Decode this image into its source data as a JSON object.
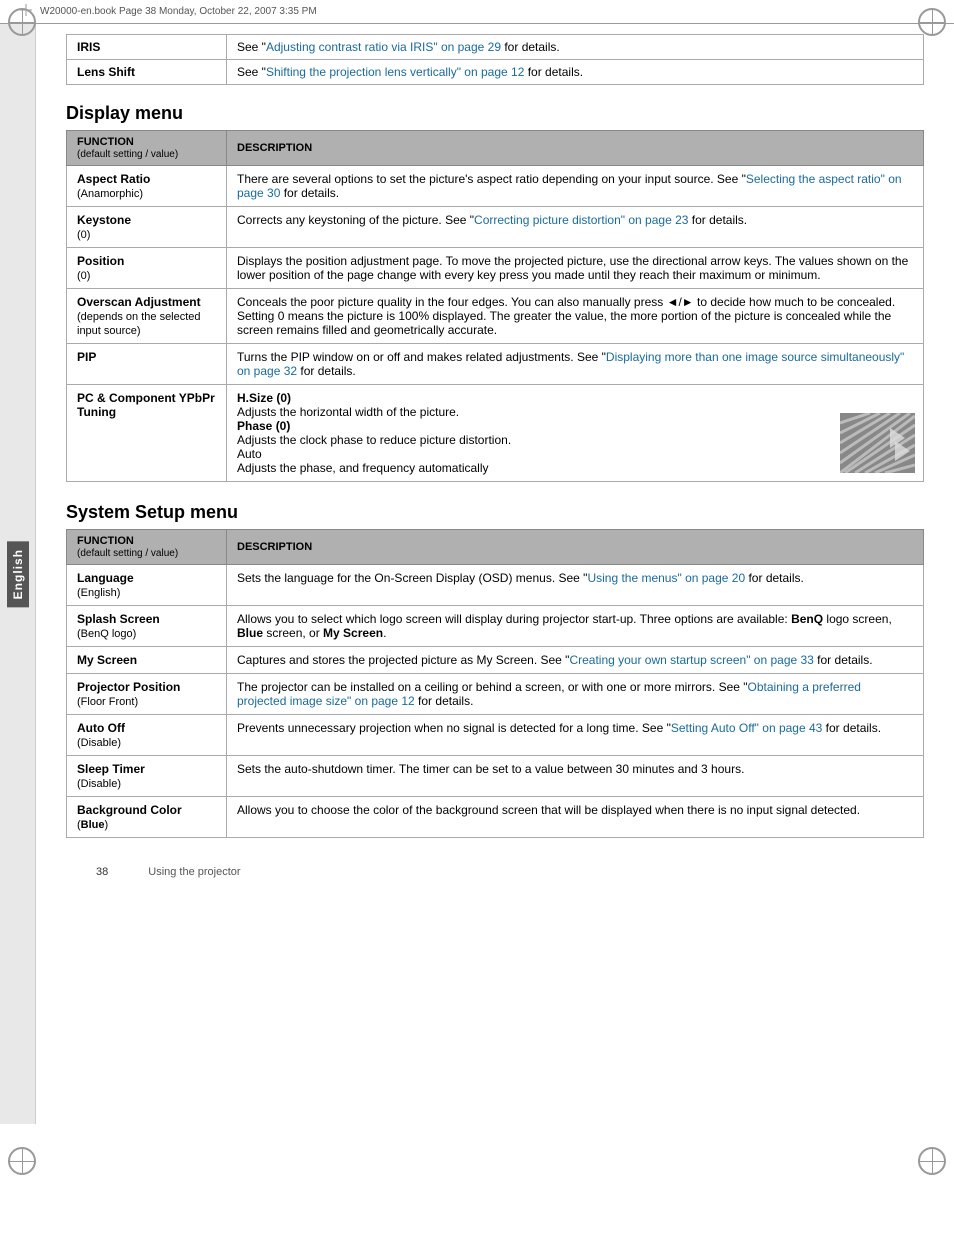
{
  "page": {
    "header_text": "W20000-en.book  Page 38  Monday, October 22, 2007  3:35 PM",
    "page_number": "38",
    "footer_text": "Using the projector",
    "sidebar_label": "English"
  },
  "top_rows": [
    {
      "label": "IRIS",
      "description": "See \"Adjusting contrast ratio via IRIS\" on page 29 for details.",
      "link_text": "Adjusting contrast ratio via IRIS\" on page 29",
      "link_prefix": "See \"",
      "link_suffix": " for details."
    },
    {
      "label": "Lens Shift",
      "description": "See \"Shifting the projection lens vertically\" on page 12 for details.",
      "link_text": "Shifting the projection lens vertically\" on page 12",
      "link_prefix": "See \"",
      "link_suffix": " for details."
    }
  ],
  "display_menu": {
    "title": "Display menu",
    "col_function": "FUNCTION",
    "col_function_sub": "(default setting / value)",
    "col_description": "DESCRIPTION",
    "rows": [
      {
        "func": "Aspect Ratio",
        "func_sub": "(Anamorphic)",
        "desc": "There are several options to set the picture's aspect ratio depending on your input source. See ",
        "desc_link": "\"Selecting the aspect ratio\" on page 30",
        "desc_suffix": " for details."
      },
      {
        "func": "Keystone",
        "func_sub": "(0)",
        "desc": "Corrects any keystoning of the picture. See ",
        "desc_link": "\"Correcting picture distortion\" on page 23",
        "desc_suffix": " for details."
      },
      {
        "func": "Position",
        "func_sub": "(0)",
        "desc": "Displays the position adjustment page. To move the projected picture, use the directional arrow keys. The values shown on the lower position of the page change with every key press you made until they reach their maximum or minimum."
      },
      {
        "func": "Overscan Adjustment",
        "func_sub": "(depends on the selected input source)",
        "desc": "Conceals the poor picture quality in the four edges. You can also manually press ◄/► to decide how much to be concealed. Setting 0 means the picture is 100% displayed. The greater the value, the more portion of the picture is concealed while the screen remains filled and geometrically accurate."
      },
      {
        "func": "PIP",
        "func_sub": "",
        "desc": "Turns the PIP window on or off and makes related adjustments. See ",
        "desc_link": "\"Displaying more than one image source simultaneously\" on page 32",
        "desc_suffix": " for details."
      },
      {
        "func": "PC & Component YPbPr Tuning",
        "func_sub": "",
        "desc_hsize": "H.Size (0)",
        "desc_hsize_text": "Adjusts the horizontal width of the picture.",
        "desc_phase": "Phase (0)",
        "desc_phase_text": "Adjusts the clock phase to reduce picture distortion.",
        "desc_auto": "Auto",
        "desc_auto_text": "Adjusts the phase, and frequency automatically",
        "has_image": true
      }
    ]
  },
  "system_setup_menu": {
    "title": "System Setup menu",
    "col_function": "FUNCTION",
    "col_function_sub": "(default setting / value)",
    "col_description": "DESCRIPTION",
    "rows": [
      {
        "func": "Language",
        "func_sub": "(English)",
        "desc": "Sets the language for the On-Screen Display (OSD) menus. See ",
        "desc_link": "\"Using the menus\" on page 20",
        "desc_suffix": " for details."
      },
      {
        "func": "Splash Screen",
        "func_sub": "(BenQ logo)",
        "desc_plain": "Allows you to select which logo screen will display during projector start-up. Three options are available: ",
        "desc_bold1": "BenQ",
        "desc_plain2": " logo screen, ",
        "desc_bold2": "Blue",
        "desc_plain3": " screen, or ",
        "desc_bold3": "My Screen",
        "desc_plain4": "."
      },
      {
        "func": "My Screen",
        "func_sub": "",
        "desc": "Captures and stores the projected picture as My Screen. See ",
        "desc_link": "\"Creating your own startup screen\" on page 33",
        "desc_suffix": " for details."
      },
      {
        "func": "Projector Position",
        "func_sub": "(Floor Front)",
        "desc": "The projector can be installed on a ceiling or behind a screen, or with one or more mirrors. See ",
        "desc_link": "\"Obtaining a preferred projected image size\" on page 12",
        "desc_suffix": " for details."
      },
      {
        "func": "Auto Off",
        "func_sub": "(Disable)",
        "desc": "Prevents unnecessary projection when no signal is detected for a long time. See ",
        "desc_link": "\"Setting Auto Off\" on page 43",
        "desc_suffix": " for details."
      },
      {
        "func": "Sleep Timer",
        "func_sub": "(Disable)",
        "desc": "Sets the auto-shutdown timer. The timer can be set to a value between 30 minutes and 3 hours."
      },
      {
        "func": "Background Color",
        "func_sub": "(Blue)",
        "func_sub_bold": true,
        "desc": "Allows you to choose the color of the background screen that will be displayed when there is no input signal detected."
      }
    ]
  }
}
